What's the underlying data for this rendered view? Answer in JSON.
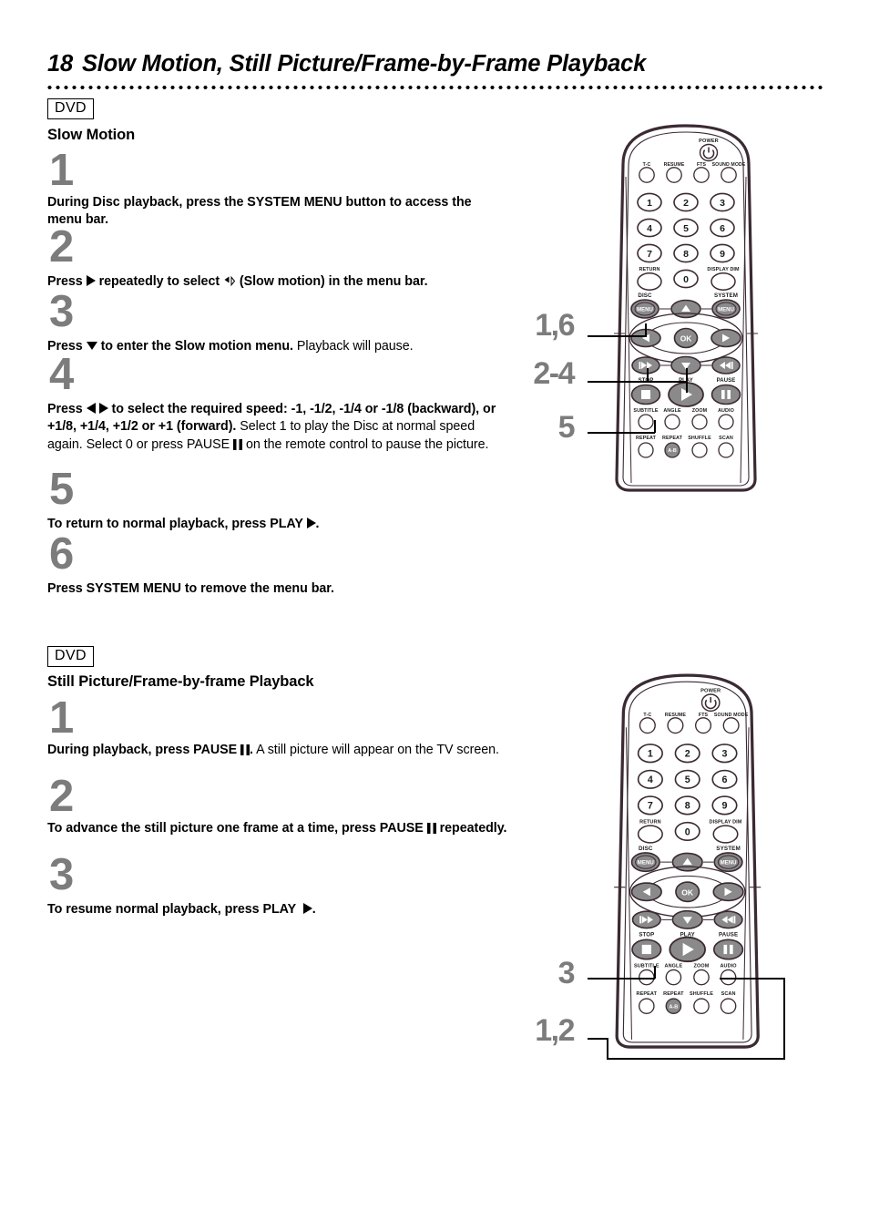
{
  "page": {
    "number": "18",
    "title": "Slow Motion, Still Picture/Frame-by-Frame Playback"
  },
  "sections": [
    {
      "media_tag": "DVD",
      "heading": "Slow Motion",
      "steps": [
        {
          "number": "1",
          "text_bold_1": "During Disc playback, press the SYSTEM MENU button to access the menu bar.",
          "text_plain_1": ""
        },
        {
          "number": "2",
          "text_bold_1": "Press ",
          "text_bold_2": " repeatedly to select ",
          "text_bold_3": " (Slow motion) in the menu bar.",
          "text_plain_1": ""
        },
        {
          "number": "3",
          "text_bold_1": "Press ",
          "text_bold_2": " to enter the Slow motion menu.",
          "text_plain_1": " Playback will pause."
        },
        {
          "number": "4",
          "text_bold_1": "Press ",
          "text_bold_2": " to select the required speed: -1, -1/2, -1/4 or -1/8 (backward), or +1/8, +1/4, +1/2 or +1 (forward).",
          "text_plain_1": " Select 1 to play the Disc at normal speed again. Select 0 or press PAUSE ",
          "text_plain_2": " on the remote control to pause the picture."
        },
        {
          "number": "5",
          "text_bold_1": "To return to normal playback,  press PLAY ",
          "text_bold_2": ".",
          "text_plain_1": ""
        },
        {
          "number": "6",
          "text_bold_1": "Press SYSTEM MENU to remove the menu bar.",
          "text_plain_1": ""
        }
      ],
      "callouts": [
        "1,6",
        "2-4",
        "5"
      ]
    },
    {
      "media_tag": "DVD",
      "heading": "Still Picture/Frame-by-frame Playback",
      "steps": [
        {
          "number": "1",
          "text_bold_1": "During playback, press PAUSE ",
          "text_bold_2": ".",
          "text_plain_1": " A still picture will appear on the TV screen."
        },
        {
          "number": "2",
          "text_bold_1": "To advance the still picture one frame at a time, press PAUSE ",
          "text_bold_2": " repeatedly.",
          "text_plain_1": ""
        },
        {
          "number": "3",
          "text_bold_1": "To resume normal playback, press PLAY ",
          "text_bold_2": ".",
          "text_plain_1": ""
        }
      ],
      "callouts": [
        "3",
        "1,2"
      ]
    }
  ],
  "remote": {
    "power_label": "POWER",
    "row_top": [
      "T-C",
      "RESUME",
      "FTS",
      "SOUND MODE"
    ],
    "keypad": [
      "1",
      "2",
      "3",
      "4",
      "5",
      "6",
      "7",
      "8",
      "9"
    ],
    "zero": "0",
    "return_label": "RETURN",
    "display_dim_label": "DISPLAY DIM",
    "disc_label": "DISC",
    "system_label": "SYSTEM",
    "menu_label": "MENU",
    "ok_label": "OK",
    "stop_label": "STOP",
    "play_label": "PLAY",
    "pause_label": "PAUSE",
    "row_fn1": [
      "SUBTITLE",
      "ANGLE",
      "ZOOM",
      "AUDIO"
    ],
    "row_fn2": [
      "REPEAT",
      "REPEAT",
      "SHUFFLE",
      "SCAN"
    ],
    "ab_label": "A-B"
  },
  "colors": {
    "step_number": "#7c7c7c",
    "callout": "#7c7c7c",
    "button_fill": "#8a8a8a",
    "remote_outline": "#3b2a33",
    "text": "#000000"
  }
}
